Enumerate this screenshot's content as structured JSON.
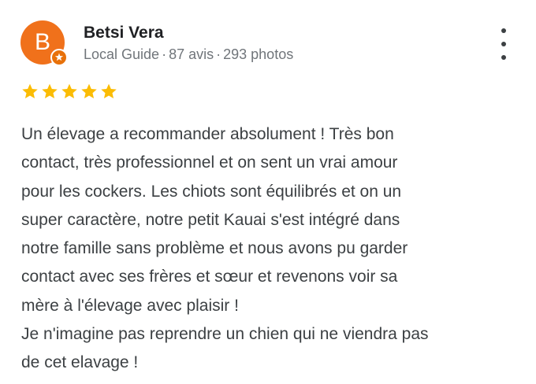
{
  "author": {
    "avatar_initial": "B",
    "name": "Betsi Vera",
    "badge": "Local Guide",
    "reviews": "87 avis",
    "photos": "293 photos",
    "separator": "·"
  },
  "rating": {
    "value": 5,
    "max": 5
  },
  "review": {
    "lines": [
      "Un élevage a recommander absolument ! Très bon",
      "contact, très professionnel et on sent un vrai amour",
      "pour les cockers. Les chiots sont équilibrés et on un",
      "super caractère, notre petit Kauai s'est intégré dans",
      "notre famille sans problème et nous avons pu garder",
      "contact avec ses frères et sœur et revenons voir sa",
      "mère à l'élevage avec plaisir !",
      "Je n'imagine pas reprendre un chien qui ne viendra pas",
      "de cet elavage !"
    ]
  },
  "colors": {
    "avatar_bg": "#f0711b",
    "star": "#fbbc04",
    "name": "#202124",
    "meta": "#70757a",
    "text": "#3c4043"
  },
  "icons": {
    "more": "more-vert-icon",
    "badge": "local-guide-star-icon",
    "star": "star-icon"
  }
}
